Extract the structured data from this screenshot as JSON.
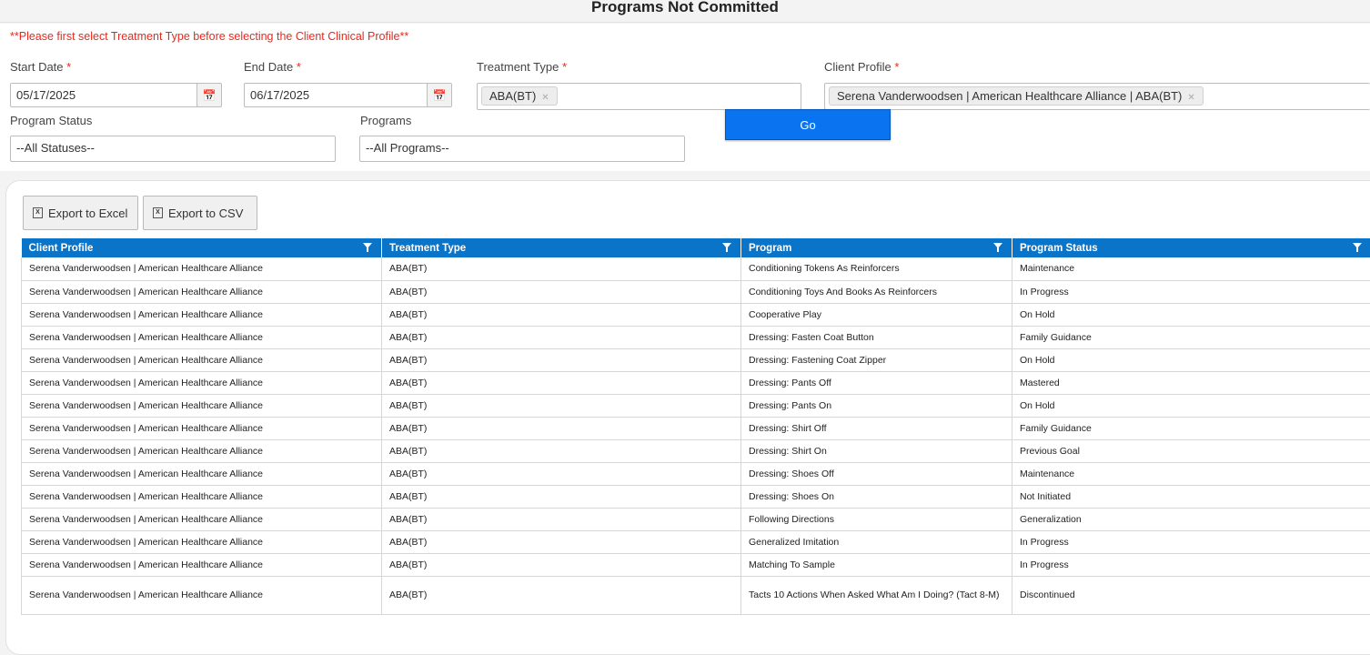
{
  "page": {
    "title": "Programs Not Committed"
  },
  "filters": {
    "warning": "**Please first select Treatment Type before selecting the Client Clinical Profile**",
    "required_mark": "*",
    "start_date": {
      "label": "Start Date",
      "value": "05/17/2025"
    },
    "end_date": {
      "label": "End Date",
      "value": "06/17/2025"
    },
    "treatment_type": {
      "label": "Treatment Type",
      "selected": "ABA(BT)"
    },
    "client_profile": {
      "label": "Client Profile",
      "selected": "Serena Vanderwoodsen | American Healthcare Alliance | ABA(BT)"
    },
    "program_status": {
      "label": "Program Status",
      "value": "--All Statuses--"
    },
    "programs": {
      "label": "Programs",
      "value": "--All Programs--"
    },
    "go_label": "Go"
  },
  "toolbar": {
    "export_excel": "Export to Excel",
    "export_csv": "Export to CSV"
  },
  "grid": {
    "columns": [
      "Client Profile",
      "Treatment Type",
      "Program",
      "Program Status"
    ],
    "rows": [
      [
        "Serena Vanderwoodsen | American Healthcare Alliance",
        "ABA(BT)",
        "Conditioning Tokens As Reinforcers",
        "Maintenance"
      ],
      [
        "Serena Vanderwoodsen | American Healthcare Alliance",
        "ABA(BT)",
        "Conditioning Toys And Books As Reinforcers",
        "In Progress"
      ],
      [
        "Serena Vanderwoodsen | American Healthcare Alliance",
        "ABA(BT)",
        "Cooperative Play",
        "On Hold"
      ],
      [
        "Serena Vanderwoodsen | American Healthcare Alliance",
        "ABA(BT)",
        "Dressing: Fasten Coat Button",
        "Family Guidance"
      ],
      [
        "Serena Vanderwoodsen | American Healthcare Alliance",
        "ABA(BT)",
        "Dressing: Fastening Coat Zipper",
        "On Hold"
      ],
      [
        "Serena Vanderwoodsen | American Healthcare Alliance",
        "ABA(BT)",
        "Dressing: Pants Off",
        "Mastered"
      ],
      [
        "Serena Vanderwoodsen | American Healthcare Alliance",
        "ABA(BT)",
        "Dressing: Pants On",
        "On Hold"
      ],
      [
        "Serena Vanderwoodsen | American Healthcare Alliance",
        "ABA(BT)",
        "Dressing: Shirt Off",
        "Family Guidance"
      ],
      [
        "Serena Vanderwoodsen | American Healthcare Alliance",
        "ABA(BT)",
        "Dressing: Shirt On",
        "Previous Goal"
      ],
      [
        "Serena Vanderwoodsen | American Healthcare Alliance",
        "ABA(BT)",
        "Dressing: Shoes Off",
        "Maintenance"
      ],
      [
        "Serena Vanderwoodsen | American Healthcare Alliance",
        "ABA(BT)",
        "Dressing: Shoes On",
        "Not Initiated"
      ],
      [
        "Serena Vanderwoodsen | American Healthcare Alliance",
        "ABA(BT)",
        "Following Directions",
        "Generalization"
      ],
      [
        "Serena Vanderwoodsen | American Healthcare Alliance",
        "ABA(BT)",
        "Generalized Imitation",
        "In Progress"
      ],
      [
        "Serena Vanderwoodsen | American Healthcare Alliance",
        "ABA(BT)",
        "Matching To Sample",
        "In Progress"
      ],
      [
        "Serena Vanderwoodsen | American Healthcare Alliance",
        "ABA(BT)",
        "Tacts 10 Actions When Asked What Am I Doing? (Tact 8-M)",
        "Discontinued"
      ]
    ]
  },
  "colors": {
    "accent": "#0a74c9",
    "go_button": "#0a74f0",
    "required": "#e8281e"
  }
}
